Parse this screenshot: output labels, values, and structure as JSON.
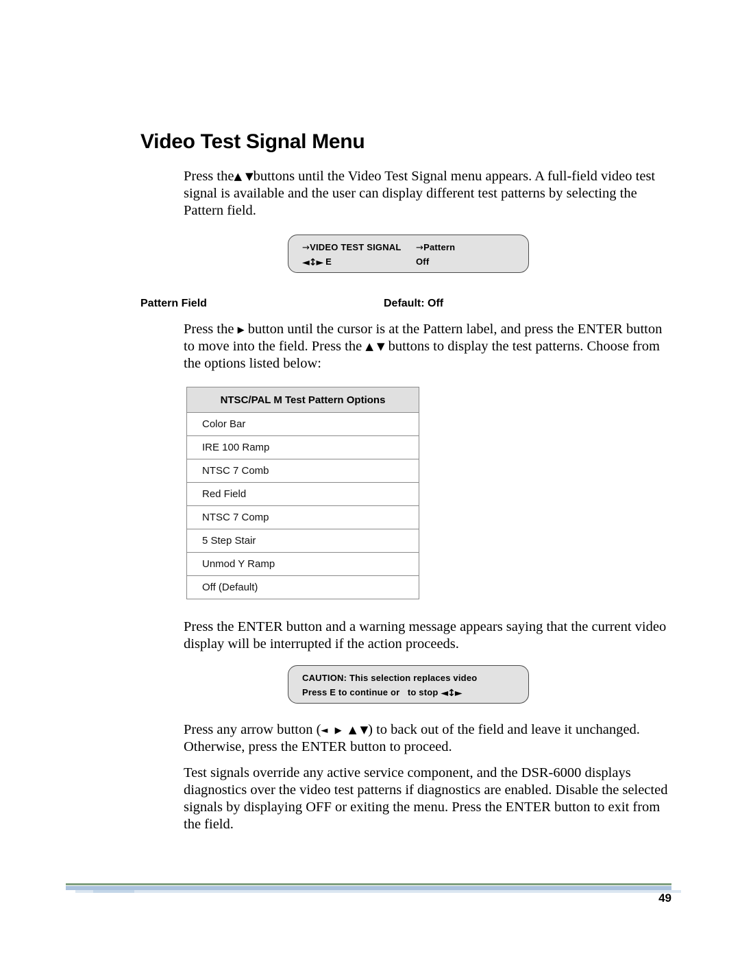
{
  "document": {
    "heading": "Video Test Signal Menu",
    "page_number": "49"
  },
  "paragraphs": {
    "intro_a": "Press the",
    "intro_b": "buttons until the Video Test Signal menu appears. A full-field video test signal is available and the user can display different test patterns by selecting the Pattern field.",
    "pattern_a": "Press the",
    "pattern_b": "button until the cursor is at the Pattern label, and press the ENTER button to move into the field. Press the",
    "pattern_c": "buttons to display the test patterns. Choose from the options listed below:",
    "warning": "Press the ENTER button and a warning message appears saying that the current video display will be interrupted if the action proceeds.",
    "backout_a": "Press any arrow button (",
    "backout_b": ") to back out of the field and leave it unchanged. Otherwise, press the ENTER button to proceed.",
    "override": "Test signals override any active service component, and the DSR-6000 displays diagnostics over the video test patterns if diagnostics are enabled. Disable the selected signals by displaying OFF or exiting the menu. Press the ENTER button to exit from the field."
  },
  "labels": {
    "field_name": "Pattern Field",
    "default_value": "Default: Off"
  },
  "menu_display": {
    "line1_left_arrow": "→",
    "line1_left_text": "VIDEO TEST SIGNAL",
    "line1_right_arrow": "→",
    "line1_right_text": "Pattern",
    "line2_left_glyph": "◄↕►",
    "line2_left_text": "E",
    "line2_right_text": "Off"
  },
  "caution_display": {
    "line1": "CAUTION: This selection replaces video",
    "line2_a": "Press E to continue or",
    "line2_b": "to stop",
    "line2_glyph": "◄↕►"
  },
  "options_table": {
    "header": "NTSC/PAL M Test Pattern Options",
    "rows": [
      "Color Bar",
      "IRE 100 Ramp",
      "NTSC 7 Comb",
      "Red Field",
      "NTSC 7 Comp",
      "5 Step Stair",
      "Unmod Y Ramp",
      "Off (Default)"
    ]
  },
  "glyphs": {
    "up": "▲",
    "down": "▼",
    "left": "◄",
    "right": "▶"
  },
  "colors": {
    "lcd_background": "#e2e2e2",
    "lcd_border": "#4a4a4a",
    "table_header_background": "#e0e0e0",
    "table_border": "#8a8a8a",
    "rule_green": "#7d9e7d",
    "rule_blue": "#aac2dd"
  }
}
